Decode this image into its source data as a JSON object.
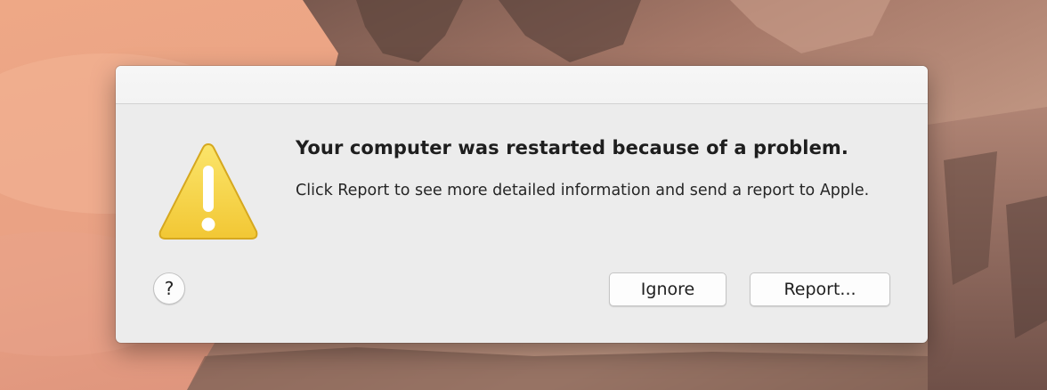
{
  "alert": {
    "title": "Your computer was restarted because of a problem.",
    "message": "Click Report to see more detailed information and send a report to Apple.",
    "help_label": "?",
    "ignore_label": "Ignore",
    "report_label": "Report..."
  },
  "icons": {
    "alert_icon": "caution-triangle-icon",
    "help_icon": "question-mark-icon"
  },
  "colors": {
    "dialog_background": "#ececec",
    "titlebar_background": "#f6f6f6",
    "caution_yellow": "#f7d13f"
  }
}
